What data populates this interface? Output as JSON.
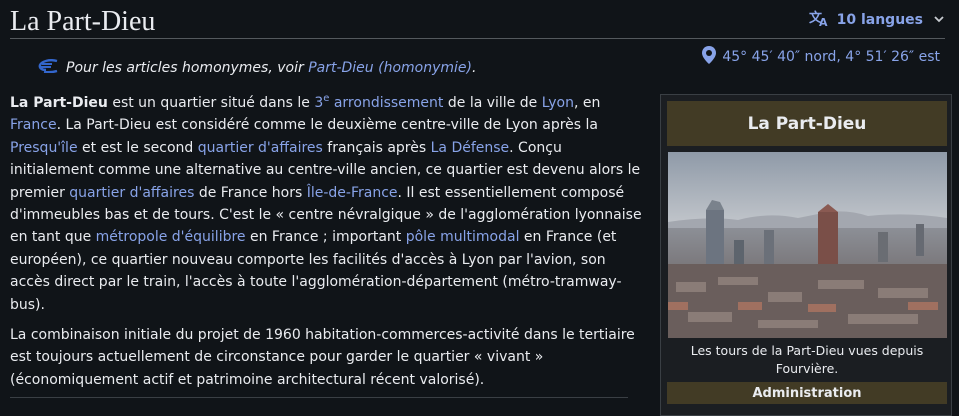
{
  "page": {
    "title": "La Part-Dieu",
    "languages_label": "10 langues",
    "coordinates": "45° 45′ 40″ nord, 4° 51′ 26″ est"
  },
  "hatnote": {
    "prefix": "Pour les articles homonymes, voir ",
    "link": "Part-Dieu (homonymie)",
    "suffix": "."
  },
  "paragraph1": {
    "s0": "La Part-Dieu",
    "s1": " est un quartier situé dans le ",
    "l_arr_num": "3",
    "l_arr_sup": "e",
    "l_arr_text": " arrondissement",
    "s2": " de la ville de ",
    "l_lyon": "Lyon",
    "s3": ", en ",
    "l_france": "France",
    "s4": ". La Part-Dieu est considéré comme le deuxième centre-ville de Lyon après la ",
    "l_presquile": "Presqu'île",
    "s5": " et est le second ",
    "l_qa1": "quartier d'affaires",
    "s6": " français après ",
    "l_defense": "La Défense",
    "s7": ". Conçu initialement comme une alternative au centre-ville ancien, ce quartier est devenu alors le premier ",
    "l_qa2": "quartier d'affaires",
    "s8": " de France hors ",
    "l_idf": "Île-de-France",
    "s9": ". Il est essentiellement composé d'immeubles bas et de tours. C'est le « centre névralgique » de l'agglomération lyonnaise en tant que ",
    "l_metropole": "métropole d'équilibre",
    "s10": " en France ; important ",
    "l_pole": "pôle multimodal",
    "s11": " en France (et européen), ce quartier nouveau comporte les facilités d'accès à Lyon par l'avion, son accès direct par le train, l'accès à toute l'agglomération-département (métro-tramway-bus)."
  },
  "paragraph2": "La combinaison initiale du projet de 1960 habitation-commerces-activité dans le tertiaire est toujours actuellement de circonstance pour garder le quartier « vivant » (économiquement actif et patrimoine architectural récent valorisé).",
  "infobox": {
    "title": "La Part-Dieu",
    "caption": "Les tours de la Part-Dieu vues depuis Fourvière.",
    "section": "Administration"
  },
  "colors": {
    "background": "#101418",
    "text": "#eaecf0",
    "link": "#88a3e8",
    "infobox_header": "#423b25"
  },
  "icons": [
    "translate-icon",
    "chevron-down-icon",
    "map-pin-icon",
    "disambiguation-icon"
  ]
}
